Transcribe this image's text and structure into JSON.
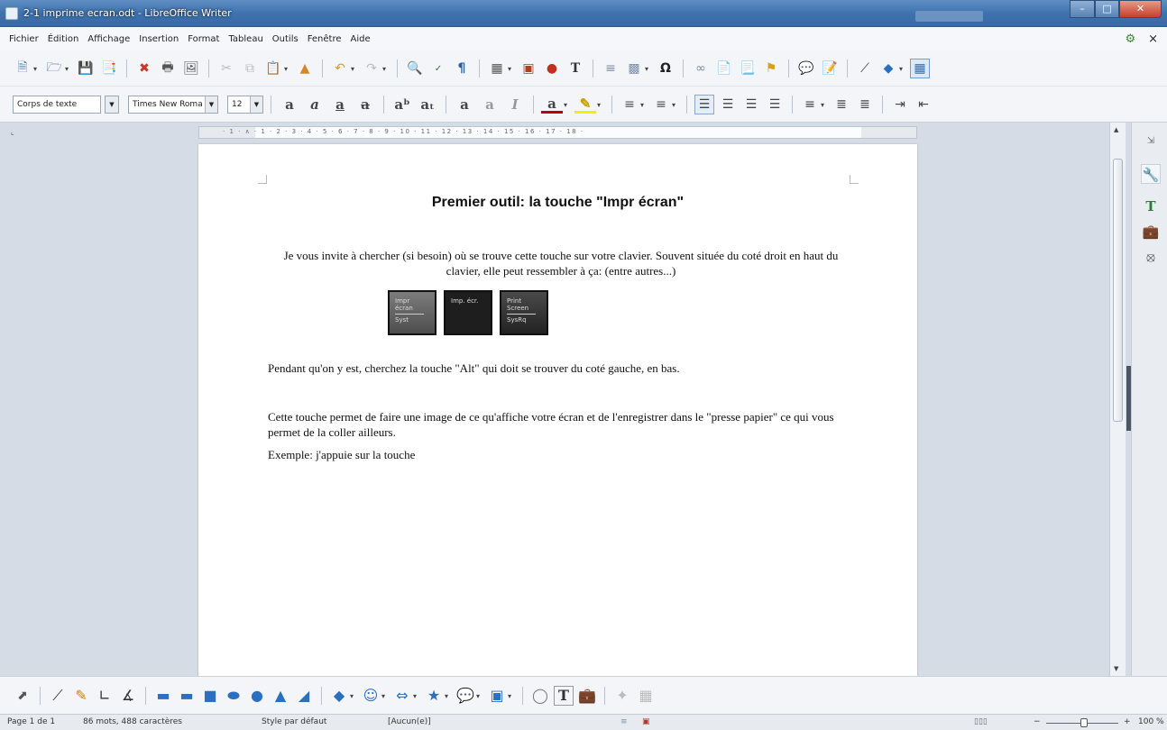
{
  "window": {
    "title": "2-1 imprime ecran.odt - LibreOffice Writer",
    "min": "–",
    "max": "□",
    "close": "✕"
  },
  "menu": {
    "items": [
      "Fichier",
      "Édition",
      "Affichage",
      "Insertion",
      "Format",
      "Tableau",
      "Outils",
      "Fenêtre",
      "Aide"
    ],
    "close_doc": "×"
  },
  "toolbar_format": {
    "paragraph_style": "Corps de texte",
    "font_name": "Times New Roma",
    "font_size": "12"
  },
  "ruler": {
    "numbers": "· 1 · ∧ · 1 · 2 · 3 · 4 · 5 · 6 · 7 · 8 · 9 · 10 · 11 · 12 · 13 · 14 · 15 · 16 · 17 · 18 ·"
  },
  "document": {
    "title": "Premier outil: la touche \"Impr écran\"",
    "p1": "Je vous invite à chercher (si besoin) où se trouve cette touche sur votre clavier. Souvent située du coté droit en haut du clavier, elle peut ressembler à ça: (entre autres...)",
    "keys": [
      {
        "top": "Impr",
        "mid": "écran",
        "bottom": "Syst"
      },
      {
        "top": "Imp. écr.",
        "mid": "",
        "bottom": ""
      },
      {
        "top": "Print",
        "mid": "Screen",
        "bottom": "SysRq"
      }
    ],
    "p2": "Pendant qu'on y est, cherchez la touche \"Alt\" qui doit se trouver du coté gauche, en bas.",
    "p3": "Cette touche permet de faire une image de ce qu'affiche votre écran et de l'enregistrer dans le \"presse papier\" ce qui vous permet de la coller ailleurs.",
    "p4": "Exemple: j'appuie sur la touche"
  },
  "status": {
    "page": "Page 1 de 1",
    "words": "86 mots, 488 caractères",
    "style": "Style par défaut",
    "language": "[Aucun(e)]",
    "zoom": "100 %",
    "zoom_minus": "−",
    "zoom_plus": "+"
  },
  "colors": {
    "accent": "#3f72ae",
    "page": "#ffffff",
    "workspace": "#d5dce6"
  }
}
